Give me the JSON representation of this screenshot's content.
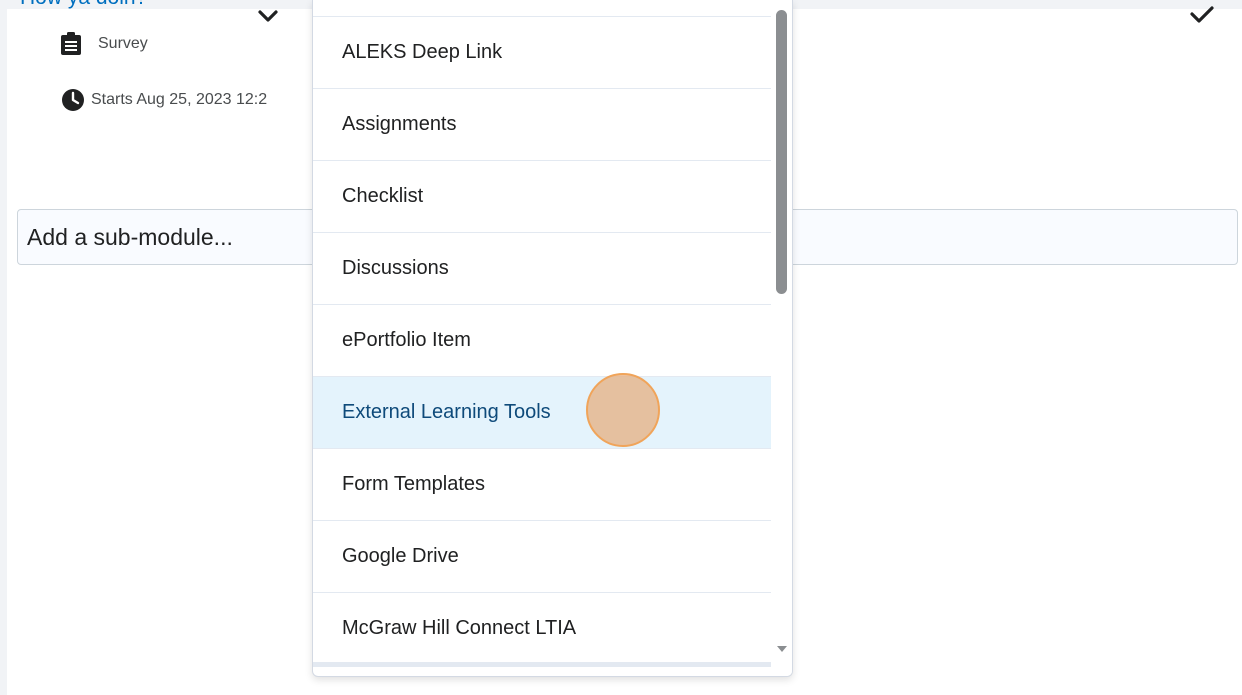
{
  "module": {
    "title": "How ya doin?",
    "item_type": "Survey",
    "start_text": "Starts Aug 25, 2023 12:2",
    "icons": {
      "item": "clipboard-list-icon",
      "start": "clock-icon",
      "expand": "chevron-down-icon",
      "complete": "checkmark-icon"
    }
  },
  "submodule": {
    "placeholder": "Add a sub-module..."
  },
  "dropdown": {
    "items": [
      "ALEKS Deep Link",
      "Assignments",
      "Checklist",
      "Discussions",
      "ePortfolio Item",
      "External Learning Tools",
      "Form Templates",
      "Google Drive",
      "McGraw Hill Connect LTIA"
    ],
    "active_item": "External Learning Tools",
    "scroll_position": 0.02
  },
  "colors": {
    "link": "#006fbf",
    "active_bg": "#e4f3fc",
    "active_text": "#0e4a7a",
    "click_marker": "#f0a45a"
  }
}
